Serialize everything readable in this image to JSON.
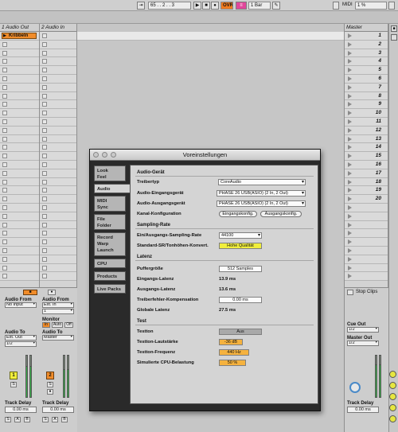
{
  "transport": {
    "tempo": "65 . . 2 . . 3",
    "ovr_label": "OVR",
    "bar_label": "1 Bar",
    "midi_label": "MIDI",
    "cpu": "1 %"
  },
  "tracks": [
    {
      "name": "1 Audio Out",
      "clip": "Kribbeln"
    },
    {
      "name": "2 Audio In",
      "clip": ""
    }
  ],
  "master": {
    "name": "Master",
    "scenes": [
      "1",
      "2",
      "3",
      "4",
      "5",
      "6",
      "7",
      "8",
      "9",
      "10",
      "11",
      "12",
      "13",
      "14",
      "15",
      "16",
      "17",
      "18",
      "19",
      "20"
    ],
    "stop_clips": "Stop Clips",
    "cue_out_label": "Cue Out",
    "cue_out_value": "1/2",
    "master_out_label": "Master Out",
    "master_out_value": "1/2",
    "track_delay_label": "Track Delay",
    "track_delay_value": "0.00 ms"
  },
  "mixer": {
    "audio_from": "Audio From",
    "no_input": "No Input",
    "ext_in": "Ext. In",
    "in1": "1",
    "audio_to": "Audio To",
    "ext_out": "Ext. Out",
    "out1": "1/2",
    "monitor": "Monitor",
    "monitor_in": "In",
    "monitor_auto": "Auto",
    "monitor_off": "Off",
    "master": "Master",
    "track1_num": "1",
    "track2_num": "2",
    "solo": "S",
    "track_delay": "Track Delay",
    "delay_value": "0.00 ms",
    "s_label": "S",
    "a_label": "A",
    "b_label": "B"
  },
  "prefs": {
    "title": "Voreinstellungen",
    "tabs": [
      "Look\nFeel",
      "Audio",
      "MIDI\nSync",
      "File\nFolder",
      "Record\nWarp\nLaunch",
      "CPU",
      "Products",
      "Live Packs"
    ],
    "sections": {
      "audio_device": "Audio-Gerät",
      "sample_rate": "Sampling-Rate",
      "latency": "Latenz",
      "test": "Test"
    },
    "rows": {
      "driver_type": "Treibertyp",
      "driver_type_value": "CoreAudio",
      "input_device": "Audio-Eingangsgerät",
      "input_device_value": "PHASE 26 USB(ASIO) (2 In, 2 Out)",
      "output_device": "Audio-Ausgangsgerät",
      "output_device_value": "PHASE 26 USB(ASIO) (2 In, 2 Out)",
      "channel_config": "Kanal-Konfiguration",
      "input_config": "Eingangskonfig.",
      "output_config": "Ausgangskonfig.",
      "io_sample_rate": "Ein/Ausgangs-Sampling-Rate",
      "io_sample_rate_value": "44100",
      "src": "Standard-SR/Tonhöhen-Konvert.",
      "src_value": "Hohe Qualität",
      "buffer_size": "Puffergröße",
      "buffer_size_value": "512 Samples",
      "input_latency": "Eingangs-Latenz",
      "input_latency_value": "13.9 ms",
      "output_latency": "Ausgangs-Latenz",
      "output_latency_value": "13.6 ms",
      "driver_error": "Treiberfehler-Kompensation",
      "driver_error_value": "0.00 ms",
      "overall_latency": "Globale Latenz",
      "overall_latency_value": "27.5 ms",
      "test_tone": "Testton",
      "test_tone_value": "Aus",
      "test_volume": "Testton-Lautstärke",
      "test_volume_value": "-36 dB",
      "test_freq": "Testton-Frequenz",
      "test_freq_value": "440 Hz",
      "cpu_load": "Simulierte CPU-Belastung",
      "cpu_load_value": "50 %"
    }
  },
  "colors": {
    "clip": "#f08c2a",
    "ovr": "#f07b1e",
    "accent_orange": "#f5b23e",
    "yellow": "#f0ee3c",
    "meter_green": "#38b24a"
  }
}
